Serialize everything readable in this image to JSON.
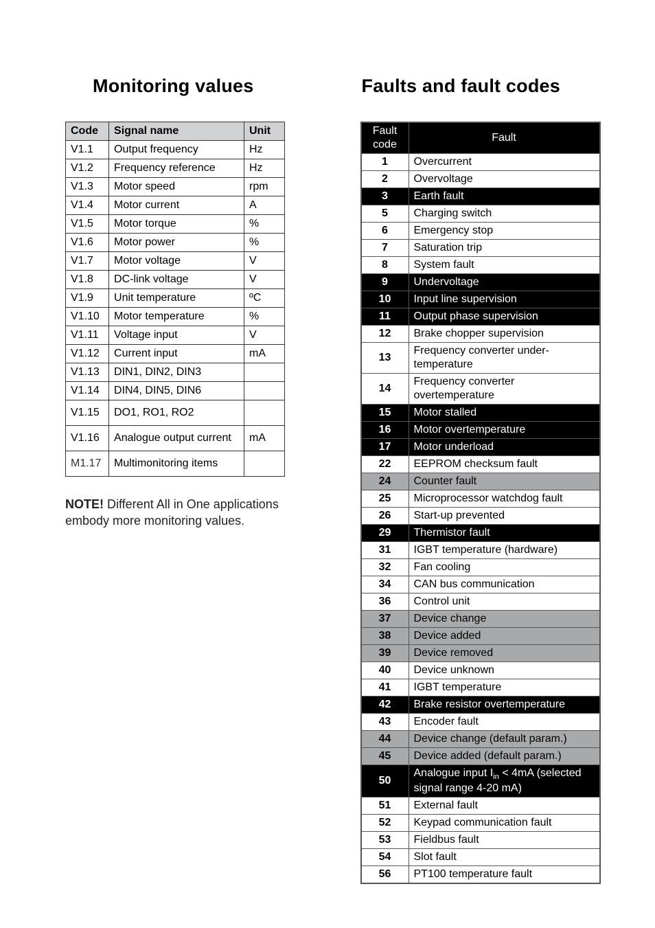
{
  "left": {
    "title": "Monitoring values",
    "headers": {
      "code": "Code",
      "signal": "Signal name",
      "unit": "Unit"
    },
    "rows": [
      {
        "code": "V1.1",
        "signal": "Output frequency",
        "unit": "Hz"
      },
      {
        "code": "V1.2",
        "signal": "Frequency reference",
        "unit": "Hz"
      },
      {
        "code": "V1.3",
        "signal": "Motor speed",
        "unit": "rpm"
      },
      {
        "code": "V1.4",
        "signal": "Motor current",
        "unit": "A"
      },
      {
        "code": "V1.5",
        "signal": "Motor torque",
        "unit": "%"
      },
      {
        "code": "V1.6",
        "signal": "Motor power",
        "unit": "%"
      },
      {
        "code": "V1.7",
        "signal": "Motor voltage",
        "unit": "V"
      },
      {
        "code": "V1.8",
        "signal": "DC-link voltage",
        "unit": "V"
      },
      {
        "code": "V1.9",
        "signal": "Unit temperature",
        "unit": "ºC"
      },
      {
        "code": "V1.10",
        "signal": "Motor temperature",
        "unit": "%"
      },
      {
        "code": "V1.11",
        "signal": "Voltage input",
        "unit": "V"
      },
      {
        "code": "V1.12",
        "signal": "Current input",
        "unit": "mA"
      },
      {
        "code": "V1.13",
        "signal": "DIN1, DIN2, DIN3",
        "unit": ""
      },
      {
        "code": "V1.14",
        "signal": "DIN4, DIN5, DIN6",
        "unit": ""
      },
      {
        "code": "V1.15",
        "signal": "DO1, RO1, RO2",
        "unit": "",
        "tall": true
      },
      {
        "code": "V1.16",
        "signal": "Analogue output current",
        "unit": "mA",
        "tall": true
      },
      {
        "code": "M1.17",
        "signal": "Multimonitoring items",
        "unit": "",
        "tall": true,
        "m": true
      }
    ],
    "note_bold": "NOTE!",
    "note_text": " Different All in One applications embody more monitoring values."
  },
  "right": {
    "title": "Faults and fault codes",
    "headers": {
      "fc": "Fault code",
      "fault": "Fault"
    },
    "rows": [
      {
        "fc": "1",
        "fault": "Overcurrent"
      },
      {
        "fc": "2",
        "fault": "Overvoltage"
      },
      {
        "fc": "3",
        "fault": "Earth fault",
        "style": "dark"
      },
      {
        "fc": "5",
        "fault": "Charging switch"
      },
      {
        "fc": "6",
        "fault": "Emergency stop"
      },
      {
        "fc": "7",
        "fault": "Saturation trip"
      },
      {
        "fc": "8",
        "fault": "System fault"
      },
      {
        "fc": "9",
        "fault": "Undervoltage",
        "style": "dark"
      },
      {
        "fc": "10",
        "fault": "Input line supervision",
        "style": "dark"
      },
      {
        "fc": "11",
        "fault": "Output phase supervision",
        "style": "dark"
      },
      {
        "fc": "12",
        "fault": "Brake chopper supervision"
      },
      {
        "fc": "13",
        "fault": "Frequency converter under-temperature"
      },
      {
        "fc": "14",
        "fault": "Frequency converter overtemperature"
      },
      {
        "fc": "15",
        "fault": "Motor stalled",
        "style": "dark"
      },
      {
        "fc": "16",
        "fault": "Motor overtemperature",
        "style": "dark"
      },
      {
        "fc": "17",
        "fault": "Motor underload",
        "style": "dark"
      },
      {
        "fc": "22",
        "fault": "EEPROM checksum fault"
      },
      {
        "fc": "24",
        "fault": "Counter fault",
        "style": "grey"
      },
      {
        "fc": "25",
        "fault": "Microprocessor watchdog fault"
      },
      {
        "fc": "26",
        "fault": "Start-up prevented"
      },
      {
        "fc": "29",
        "fault": "Thermistor fault",
        "style": "dark"
      },
      {
        "fc": "31",
        "fault": "IGBT temperature (hardware)"
      },
      {
        "fc": "32",
        "fault": "Fan cooling"
      },
      {
        "fc": "34",
        "fault": "CAN bus communication"
      },
      {
        "fc": "36",
        "fault": "Control unit"
      },
      {
        "fc": "37",
        "fault": "Device change",
        "style": "grey"
      },
      {
        "fc": "38",
        "fault": "Device added",
        "style": "grey"
      },
      {
        "fc": "39",
        "fault": "Device removed",
        "style": "grey"
      },
      {
        "fc": "40",
        "fault": "Device unknown"
      },
      {
        "fc": "41",
        "fault": "IGBT temperature"
      },
      {
        "fc": "42",
        "fault": "Brake resistor overtemperature",
        "style": "dark"
      },
      {
        "fc": "43",
        "fault": "Encoder fault"
      },
      {
        "fc": "44",
        "fault": "Device change (default param.)",
        "style": "grey"
      },
      {
        "fc": "45",
        "fault": "Device added (default param.)",
        "style": "grey"
      },
      {
        "fc": "50",
        "fault": "Analogue input I<sub>in</sub> < 4mA (selected signal range 4-20 mA)",
        "style": "dark",
        "html": true
      },
      {
        "fc": "51",
        "fault": "External fault"
      },
      {
        "fc": "52",
        "fault": "Keypad communication fault"
      },
      {
        "fc": "53",
        "fault": "Fieldbus fault"
      },
      {
        "fc": "54",
        "fault": "Slot fault"
      },
      {
        "fc": "56",
        "fault": "PT100 temperature fault"
      }
    ]
  }
}
